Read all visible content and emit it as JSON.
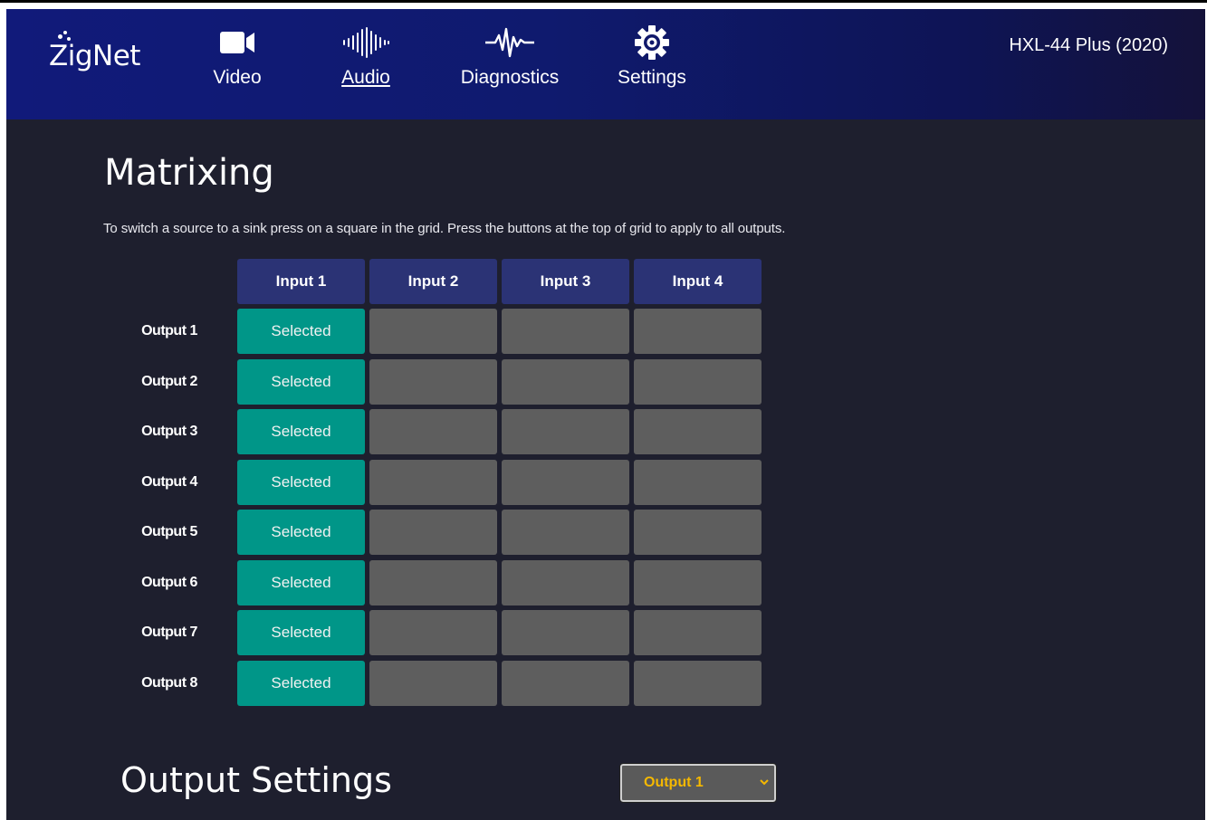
{
  "header": {
    "logo_text": "ZigNet",
    "nav": [
      {
        "label": "Video",
        "icon": "video-camera-icon",
        "active": false
      },
      {
        "label": "Audio",
        "icon": "audio-waveform-icon",
        "active": true
      },
      {
        "label": "Diagnostics",
        "icon": "heartbeat-icon",
        "active": false
      },
      {
        "label": "Settings",
        "icon": "gear-icon",
        "active": false
      }
    ],
    "device_name": "HXL-44 Plus (2020)"
  },
  "matrixing": {
    "title": "Matrixing",
    "description": "To switch a source to a sink press on a square in the grid. Press the buttons at the top of grid to apply to all outputs.",
    "inputs": [
      "Input 1",
      "Input 2",
      "Input 3",
      "Input 4"
    ],
    "outputs": [
      "Output 1",
      "Output 2",
      "Output 3",
      "Output 4",
      "Output 5",
      "Output 6",
      "Output 7",
      "Output 8"
    ],
    "selected_input_per_output": [
      1,
      1,
      1,
      1,
      1,
      1,
      1,
      1
    ],
    "selected_label": "Selected"
  },
  "output_settings": {
    "title": "Output Settings",
    "selected_output": "Output 1"
  },
  "colors": {
    "header_start": "#111a7a",
    "background": "#1e1f2e",
    "column_header": "#2b3375",
    "selected_cell": "#009688",
    "unselected_cell": "#5e5e5e",
    "select_text": "#f5b800"
  }
}
